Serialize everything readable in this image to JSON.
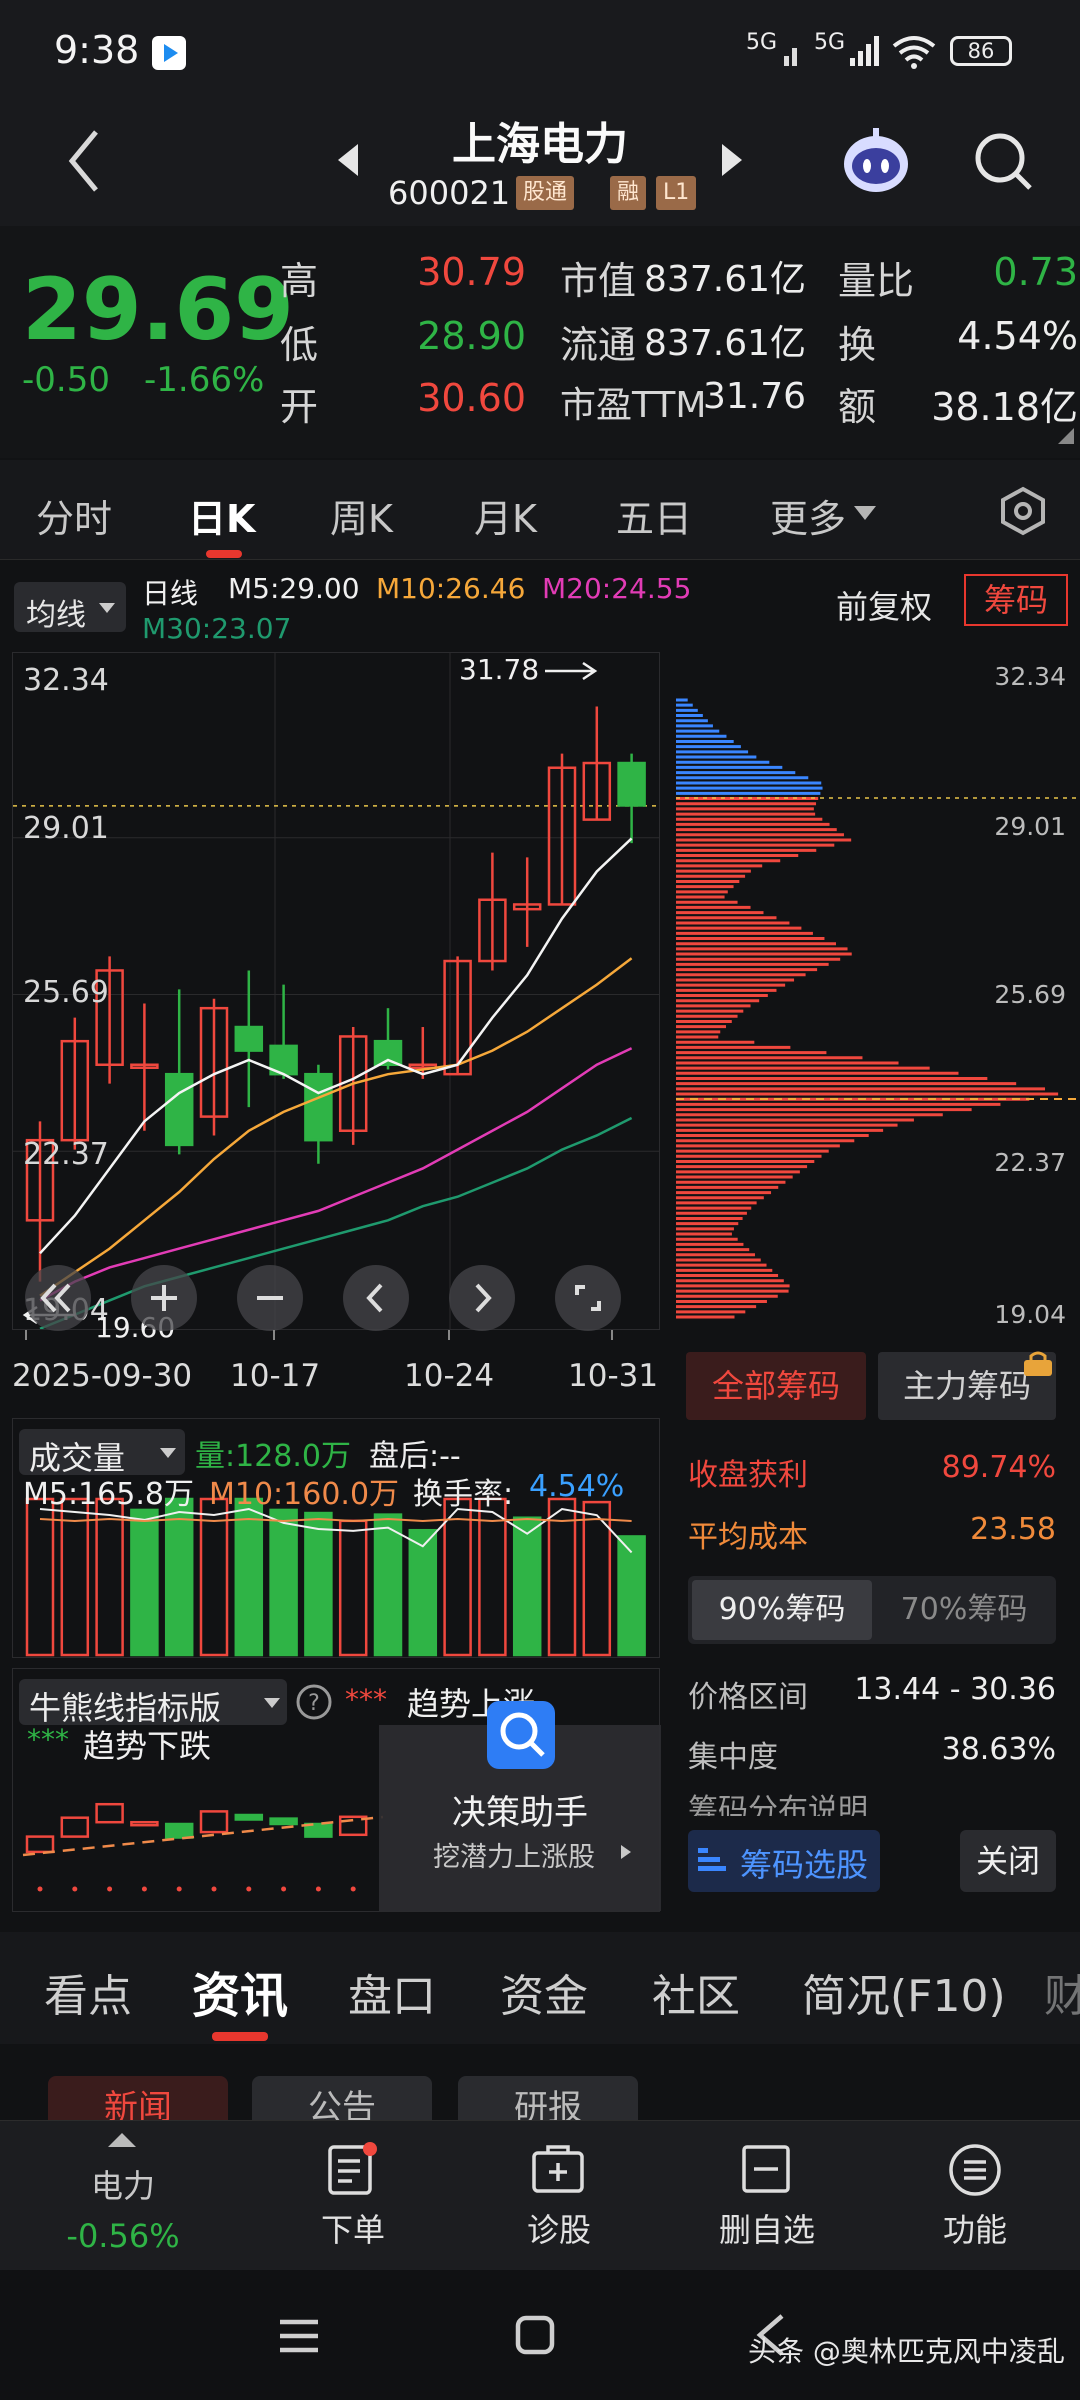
{
  "status": {
    "time": "9:38",
    "net1": "5G",
    "net2": "5G",
    "battery": "86"
  },
  "header": {
    "name": "上海电力",
    "code": "600021",
    "tag1": "股通",
    "tag2": "融",
    "tag3": "L1"
  },
  "quote": {
    "price": "29.69",
    "change": "-0.50",
    "change_pct": "-1.66%",
    "high_label": "高",
    "high": "30.79",
    "low_label": "低",
    "low": "28.90",
    "open_label": "开",
    "open": "30.60",
    "mcap_label": "市值",
    "mcap": "837.61亿",
    "float_label": "流通",
    "float": "837.61亿",
    "pe_label": "市盈TTM",
    "pe": "31.76",
    "vr_label": "量比",
    "vr": "0.73",
    "turn_label": "换",
    "turn": "4.54%",
    "amt_label": "额",
    "amt": "38.18亿"
  },
  "period_tabs": [
    "分时",
    "日K",
    "周K",
    "月K",
    "五日",
    "更多"
  ],
  "ma_legend": {
    "type": "均线",
    "kind": "日线",
    "m5": "M5:29.00",
    "m10": "M10:26.46",
    "m20": "M20:24.55",
    "m30": "M30:23.07",
    "adjust": "前复权",
    "chip": "筹码"
  },
  "kline": {
    "y_labels": [
      "32.34",
      "29.01",
      "25.69",
      "22.37",
      "19.04"
    ],
    "high_mark": "31.78",
    "low_mark": "19.60",
    "x_labels": [
      "2025-09-30",
      "10-17",
      "10-24",
      "10-31"
    ]
  },
  "chart_data": {
    "type": "candlestick",
    "ylim": [
      19.04,
      32.34
    ],
    "candles": [
      {
        "o": 20.9,
        "c": 22.6,
        "h": 23.0,
        "l": 19.6
      },
      {
        "o": 22.6,
        "c": 24.7,
        "h": 25.2,
        "l": 22.4
      },
      {
        "o": 24.2,
        "c": 26.2,
        "h": 26.5,
        "l": 23.8
      },
      {
        "o": 24.2,
        "c": 24.2,
        "h": 25.5,
        "l": 22.8
      },
      {
        "o": 24.0,
        "c": 22.5,
        "h": 25.8,
        "l": 22.3
      },
      {
        "o": 23.1,
        "c": 25.4,
        "h": 25.6,
        "l": 22.7
      },
      {
        "o": 25.0,
        "c": 24.5,
        "h": 26.2,
        "l": 23.3
      },
      {
        "o": 24.6,
        "c": 24.0,
        "h": 25.9,
        "l": 23.9
      },
      {
        "o": 24.0,
        "c": 22.6,
        "h": 24.2,
        "l": 22.1
      },
      {
        "o": 22.8,
        "c": 24.8,
        "h": 25.0,
        "l": 22.5
      },
      {
        "o": 24.7,
        "c": 24.2,
        "h": 25.4,
        "l": 24.1
      },
      {
        "o": 24.2,
        "c": 24.2,
        "h": 25.0,
        "l": 23.9
      },
      {
        "o": 24.0,
        "c": 26.4,
        "h": 26.5,
        "l": 24.0
      },
      {
        "o": 26.4,
        "c": 27.7,
        "h": 28.7,
        "l": 26.2
      },
      {
        "o": 27.5,
        "c": 27.6,
        "h": 28.6,
        "l": 26.7
      },
      {
        "o": 27.6,
        "c": 30.5,
        "h": 30.8,
        "l": 27.6
      },
      {
        "o": 29.4,
        "c": 30.6,
        "h": 31.8,
        "l": 29.4
      },
      {
        "o": 30.6,
        "c": 29.7,
        "h": 30.8,
        "l": 28.9
      }
    ],
    "ma5": [
      20.2,
      21.0,
      22.0,
      23.0,
      23.6,
      24.0,
      24.3,
      24.0,
      23.6,
      23.9,
      24.3,
      24.0,
      24.2,
      25.2,
      26.1,
      27.3,
      28.3,
      29.0
    ],
    "ma10": [
      19.3,
      19.8,
      20.3,
      20.9,
      21.5,
      22.2,
      22.8,
      23.2,
      23.5,
      23.8,
      24.0,
      24.1,
      24.2,
      24.5,
      24.9,
      25.4,
      25.9,
      26.46
    ],
    "ma20": [
      19.2,
      19.6,
      19.9,
      20.1,
      20.3,
      20.5,
      20.7,
      20.9,
      21.1,
      21.4,
      21.7,
      22.0,
      22.4,
      22.8,
      23.2,
      23.7,
      24.2,
      24.55
    ],
    "ma30": [
      18.6,
      18.9,
      19.2,
      19.5,
      19.7,
      19.9,
      20.1,
      20.3,
      20.5,
      20.7,
      20.9,
      21.2,
      21.4,
      21.7,
      22.0,
      22.4,
      22.7,
      23.07
    ],
    "volume": [
      100,
      100,
      100,
      93,
      100,
      100,
      100,
      93,
      91,
      86,
      90,
      80,
      100,
      100,
      88,
      100,
      98,
      76
    ],
    "volume_up": [
      true,
      true,
      true,
      false,
      false,
      true,
      false,
      false,
      false,
      true,
      false,
      false,
      true,
      true,
      false,
      true,
      true,
      false
    ],
    "chip_profile": [
      3,
      10,
      20,
      38,
      35,
      45,
      20,
      12,
      30,
      46,
      30,
      18,
      10,
      60,
      100,
      60,
      40,
      30,
      20,
      14,
      22,
      30,
      15
    ]
  },
  "volume_panel": {
    "title": "成交量",
    "vol": "量:128.0万",
    "after": "盘后:--",
    "m5": "M5:165.8万",
    "m10": "M10:160.0万",
    "turn_label": "换手率:",
    "turn": "4.54%"
  },
  "indicator_panel": {
    "title": "牛熊线指标版",
    "up": "趋势上涨",
    "down": "趋势下跌",
    "assist_title": "决策助手",
    "assist_sub": "挖潜力上涨股"
  },
  "chip_panel": {
    "y_labels": [
      "32.34",
      "29.01",
      "25.69",
      "22.37",
      "19.04"
    ],
    "tab_all": "全部筹码",
    "tab_main": "主力筹码",
    "profit_label": "收盘获利",
    "profit": "89.74%",
    "cost_label": "平均成本",
    "cost": "23.58",
    "p90": "90%筹码",
    "p70": "70%筹码",
    "range_label": "价格区间",
    "range": "13.44 - 30.36",
    "conc_label": "集中度",
    "conc": "38.63%",
    "desc": "筹码分布说明",
    "select_btn": "筹码选股",
    "close_btn": "关闭"
  },
  "info_tabs": [
    "看点",
    "资讯",
    "盘口",
    "资金",
    "社区",
    "简况(F10)",
    "财"
  ],
  "sub_tabs": [
    "新闻",
    "公告",
    "研报"
  ],
  "bottom_nav": {
    "sector": "电力",
    "sector_chg": "-0.56%",
    "order": "下单",
    "diagnose": "诊股",
    "remove": "删自选",
    "func": "功能"
  },
  "watermark": "头条 @奥林匹克风中凌乱"
}
